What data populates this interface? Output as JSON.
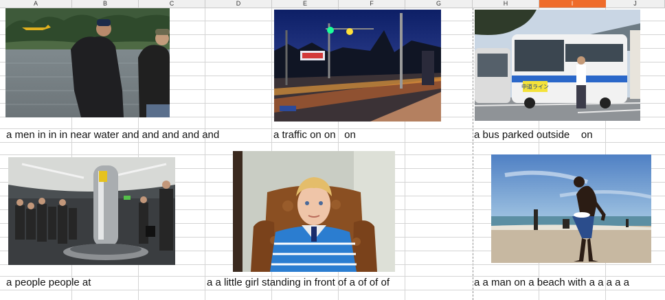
{
  "columns": [
    "A",
    "B",
    "C",
    "D",
    "E",
    "F",
    "G",
    "H",
    "I",
    "J"
  ],
  "selected_column": "I",
  "captions": {
    "lake": "a men in in in near water and and and and and",
    "traffic": "a traffic on on   on",
    "bus": "a bus parked outside    on",
    "airport": "a people people at",
    "boy": "a a little girl standing in front of a of of of",
    "beach": "a a man on a beach with a a a a a"
  },
  "bus_sign": "中道ライン",
  "colors": {
    "accent": "#ef6b2a",
    "grid": "#d4d4d4",
    "header_bg": "#f0f0f0"
  }
}
